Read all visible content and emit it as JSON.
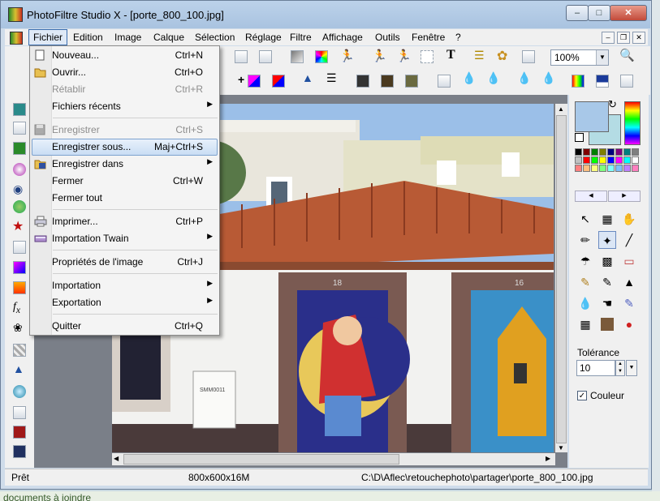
{
  "window": {
    "title": "PhotoFiltre Studio X - [porte_800_100.jpg]"
  },
  "menubar": {
    "items": [
      "Fichier",
      "Edition",
      "Image",
      "Calque",
      "Sélection",
      "Réglage",
      "Filtre",
      "Affichage",
      "Outils",
      "Fenêtre",
      "?"
    ]
  },
  "fichier_menu": {
    "items": [
      {
        "label": "Nouveau...",
        "shortcut": "Ctrl+N",
        "enabled": true,
        "icon": "new-file-icon"
      },
      {
        "label": "Ouvrir...",
        "shortcut": "Ctrl+O",
        "enabled": true,
        "icon": "open-folder-icon"
      },
      {
        "label": "Rétablir",
        "shortcut": "Ctrl+R",
        "enabled": false
      },
      {
        "label": "Fichiers récents",
        "shortcut": "",
        "submenu": true,
        "enabled": true
      },
      {
        "label": "Enregistrer",
        "shortcut": "Ctrl+S",
        "enabled": false,
        "icon": "save-icon"
      },
      {
        "label": "Enregistrer sous...",
        "shortcut": "Maj+Ctrl+S",
        "enabled": true,
        "highlighted": true
      },
      {
        "label": "Enregistrer dans",
        "shortcut": "",
        "submenu": true,
        "enabled": true,
        "icon": "save-in-icon"
      },
      {
        "label": "Fermer",
        "shortcut": "Ctrl+W",
        "enabled": true
      },
      {
        "label": "Fermer tout",
        "shortcut": "",
        "enabled": true
      },
      {
        "label": "Imprimer...",
        "shortcut": "Ctrl+P",
        "enabled": true,
        "icon": "printer-icon"
      },
      {
        "label": "Importation Twain",
        "shortcut": "",
        "submenu": true,
        "enabled": true,
        "icon": "scanner-icon"
      },
      {
        "label": "Propriétés de l'image",
        "shortcut": "Ctrl+J",
        "enabled": true
      },
      {
        "label": "Importation",
        "shortcut": "",
        "submenu": true,
        "enabled": true
      },
      {
        "label": "Exportation",
        "shortcut": "",
        "submenu": true,
        "enabled": true
      },
      {
        "label": "Quitter",
        "shortcut": "Ctrl+Q",
        "enabled": true
      }
    ]
  },
  "toolbar": {
    "zoom": "100%"
  },
  "image": {
    "door_left_number": "18",
    "door_right_number": "16",
    "sign_text": "SMM0011"
  },
  "rightpanel": {
    "tolerance_label": "Tolérance",
    "tolerance_value": "10",
    "couleur_label": "Couleur",
    "couleur_checked": true,
    "foreground_color": "#a8c8e8",
    "background_color": "#b4dce4",
    "palette": [
      "#000000",
      "#7f0000",
      "#007f00",
      "#7f7f00",
      "#00007f",
      "#7f007f",
      "#007f7f",
      "#7f7f7f",
      "#c0c0c0",
      "#ff0000",
      "#00ff00",
      "#ffff00",
      "#0000ff",
      "#ff00ff",
      "#00ffff",
      "#ffffff",
      "#ff7f7f",
      "#ffbf7f",
      "#ffff7f",
      "#7fff7f",
      "#7fffff",
      "#7fbfff",
      "#bf7fff",
      "#ff7fbf"
    ]
  },
  "status": {
    "state": "Prêt",
    "size": "800x600x16M",
    "path": "C:\\D\\Aflec\\retouchephoto\\partager\\porte_800_100.jpg"
  },
  "desktop": {
    "text": "documents à joindre"
  }
}
